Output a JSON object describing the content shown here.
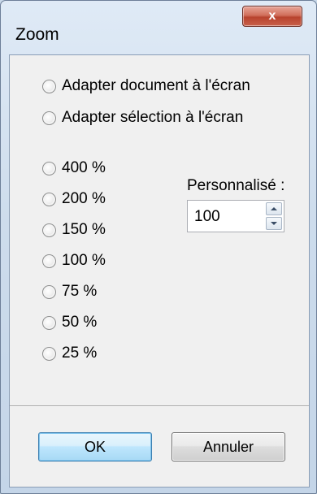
{
  "window": {
    "title": "Zoom",
    "close_glyph": "x",
    "close_icon": "close-icon"
  },
  "fit_options": [
    {
      "label": "Adapter document à l'écran"
    },
    {
      "label": "Adapter sélection à l'écran"
    }
  ],
  "presets": [
    {
      "label": "400 %"
    },
    {
      "label": "200 %"
    },
    {
      "label": "150 %"
    },
    {
      "label": "100 %"
    },
    {
      "label": "75 %"
    },
    {
      "label": "50 %"
    },
    {
      "label": "25 %"
    }
  ],
  "custom": {
    "label": "Personnalisé :",
    "value": "100"
  },
  "buttons": {
    "ok": "OK",
    "cancel": "Annuler"
  }
}
